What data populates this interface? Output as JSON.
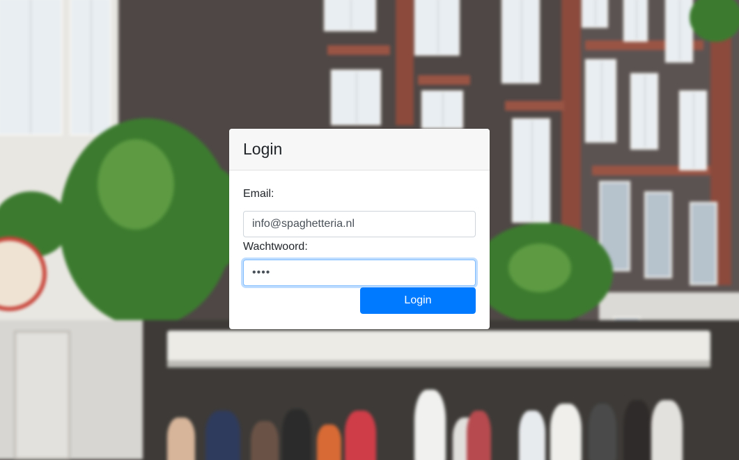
{
  "login": {
    "title": "Login",
    "email_label": "Email:",
    "email_value": "info@spaghetteria.nl",
    "password_label": "Wachtwoord:",
    "password_value": "pass",
    "submit_label": "Login"
  },
  "colors": {
    "primary": "#007bff",
    "card_header_bg": "#f7f7f7",
    "focus_border": "#80bdff"
  }
}
